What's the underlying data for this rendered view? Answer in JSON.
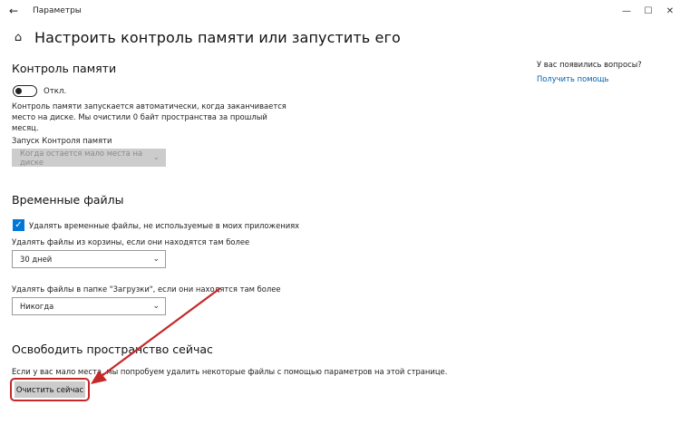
{
  "window": {
    "title": "Параметры",
    "back_glyph": "←",
    "minimize_glyph": "—",
    "maximize_glyph": "☐",
    "close_glyph": "✕"
  },
  "header": {
    "title": "Настроить контроль памяти или запустить его",
    "home_glyph": "⌂"
  },
  "storage_sense": {
    "title": "Контроль памяти",
    "toggle_label": "Откл.",
    "toggle_state": "off",
    "description_line1": "Контроль памяти запускается автоматически, когда заканчивается",
    "description_line2": "место на диске. Мы очистили 0 байт пространства за прошлый",
    "description_line3": "месяц.",
    "run_label": "Запуск Контроля памяти",
    "run_value": "Когда остается мало места на диске"
  },
  "temp_files": {
    "title": "Временные файлы",
    "checkbox_label": "Удалять временные файлы, не используемые в моих приложениях",
    "checkbox_checked": true,
    "check_glyph": "✓",
    "recycle_label": "Удалять файлы из корзины, если они находятся там более",
    "recycle_value": "30 дней",
    "downloads_label": "Удалять файлы в папке \"Загрузки\", если они находятся там более",
    "downloads_value": "Никогда",
    "chevron_glyph": "⌄"
  },
  "free_now": {
    "title": "Освободить пространство сейчас",
    "description": "Если у вас мало места, мы попробуем удалить некоторые файлы с помощью параметров на этой странице.",
    "button_label": "Очистить сейчас"
  },
  "help": {
    "question": "У вас появились вопросы?",
    "link": "Получить помощь"
  },
  "colors": {
    "accent": "#0078d7",
    "link": "#0063b1",
    "annotation": "#c62828",
    "button_bg": "#cccccc"
  }
}
